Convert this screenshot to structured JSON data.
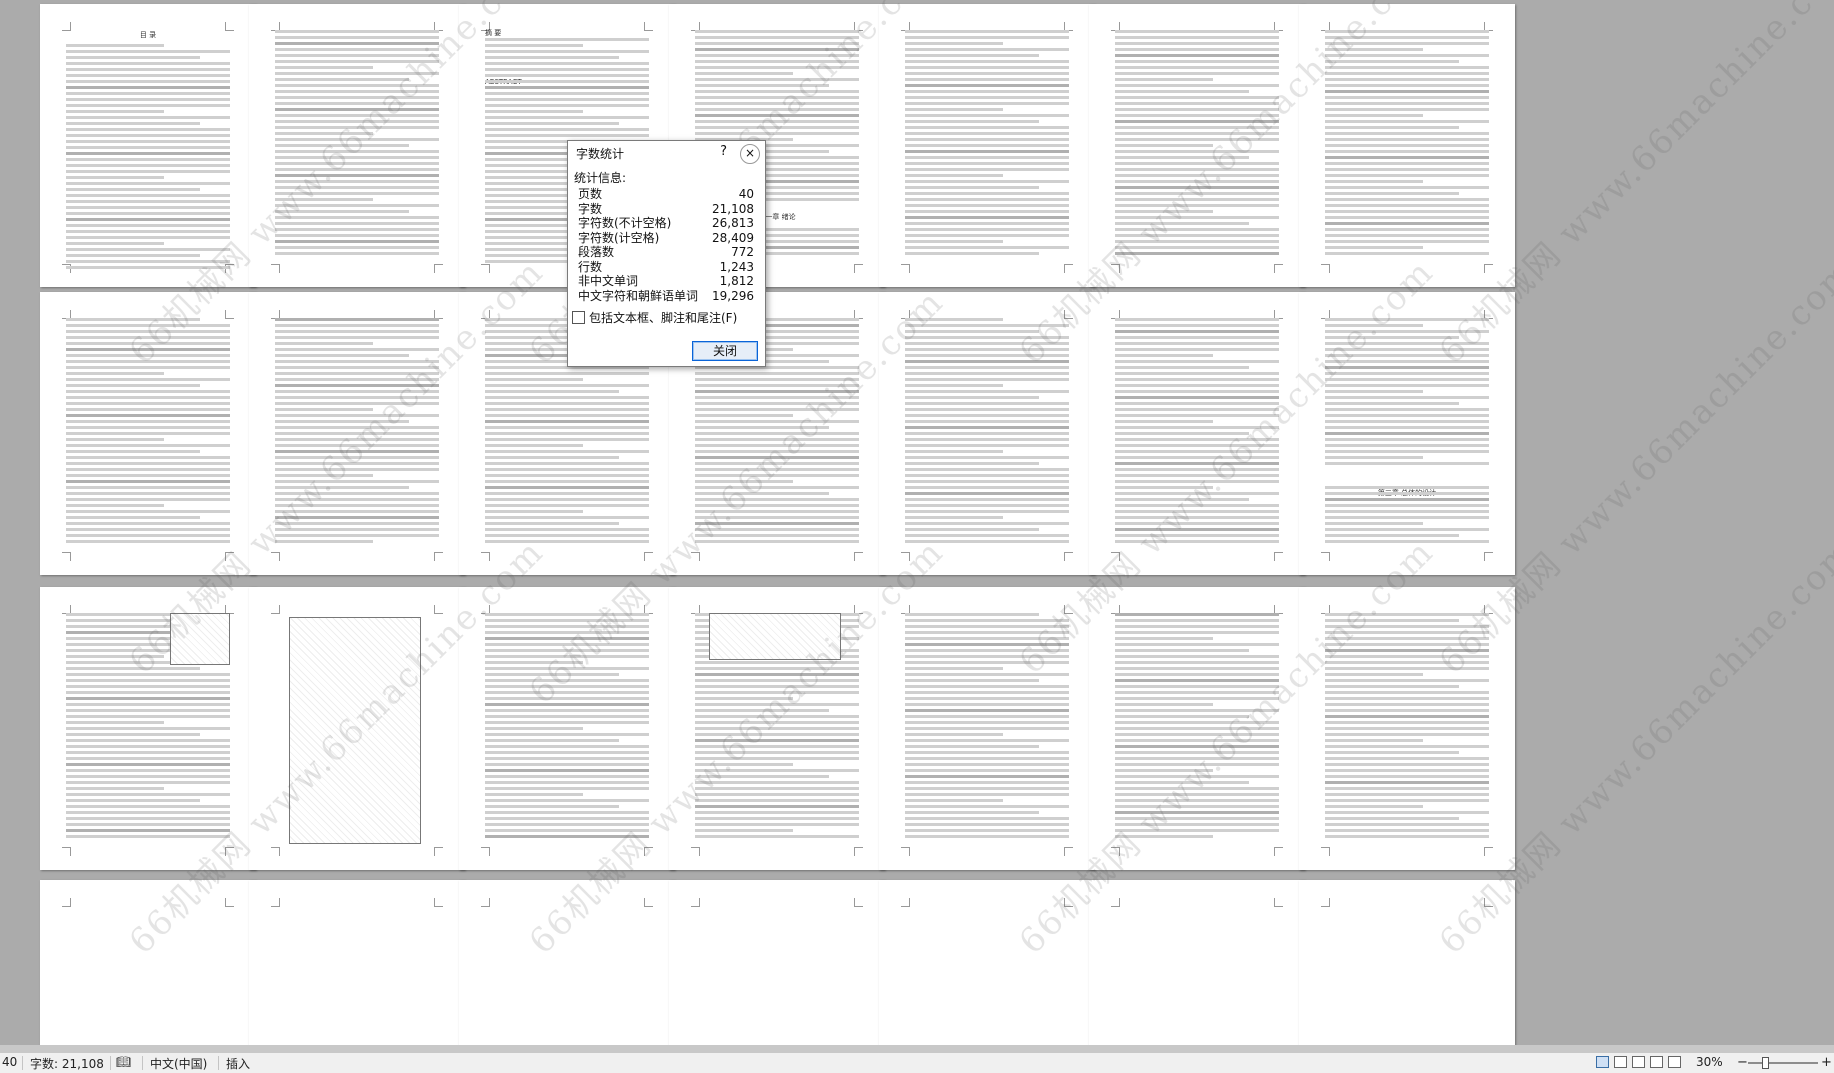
{
  "word_count_dialog": {
    "title": "字数统计",
    "help_glyph": "?",
    "close_glyph": "×",
    "section_heading": "统计信息:",
    "stats": [
      {
        "label": "页数",
        "value": "40"
      },
      {
        "label": "字数",
        "value": "21,108"
      },
      {
        "label": "字符数(不计空格)",
        "value": "26,813"
      },
      {
        "label": "字符数(计空格)",
        "value": "28,409"
      },
      {
        "label": "段落数",
        "value": "772"
      },
      {
        "label": "行数",
        "value": "1,243"
      },
      {
        "label": "非中文单词",
        "value": "1,812"
      },
      {
        "label": "中文字符和朝鲜语单词",
        "value": "19,296"
      }
    ],
    "include_checkbox_label": "包括文本框、脚注和尾注(F)",
    "include_checked": false,
    "close_button_label": "关闭"
  },
  "document_pages": {
    "toc_title": "目 录",
    "abstract_title": "摘 要",
    "abstract_en_title": "ABSTRACT",
    "chapter1_heading": "第一章 绪论",
    "chapter3_heading": "第三章 总体的设计",
    "watermark_text": "66机械网 www.66machine.com"
  },
  "status_bar": {
    "page_fragment": "40",
    "word_count": "字数: 21,108",
    "language": "中文(中国)",
    "mode": "插入",
    "zoom": "30%",
    "zoom_out": "−",
    "zoom_in": "+"
  }
}
